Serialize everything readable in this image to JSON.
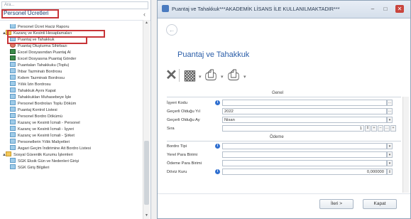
{
  "left_panel": {
    "search_placeholder": "Ara...",
    "title": "Personel Ücretleri",
    "collapse_icon": "chevron-left-icon",
    "tree": [
      {
        "label": "Personel Ücret Haciz Raporu",
        "icon": "doc-icon"
      },
      {
        "label": "Kazanç ve Kesinti Hesaplamaları",
        "icon": "folder-icon",
        "expander": "▲"
      },
      {
        "label": "Puantaj ve Tahakkuk",
        "icon": "doc-icon"
      },
      {
        "label": "Puantaj Oluşturma Sihirbazı",
        "icon": "wizard-icon"
      },
      {
        "label": "Excel Dosyasından Puantaj Al",
        "icon": "excel-icon"
      },
      {
        "label": "Excel Dosyasına Puantaj Gönder",
        "icon": "excel-icon"
      },
      {
        "label": "Puantaları Tahakkuku (Toplu)",
        "icon": "doc-icon"
      },
      {
        "label": "İhbar Tazminatı Bordrosu",
        "icon": "doc-icon"
      },
      {
        "label": "Kıdem Tazminatı Bordrosu",
        "icon": "doc-icon"
      },
      {
        "label": "Yıllık İzin Bordrosu",
        "icon": "doc-icon"
      },
      {
        "label": "Tahakkuk Ayını Kapat",
        "icon": "doc-icon"
      },
      {
        "label": "Tahakkukları Muhasebeye İşle",
        "icon": "doc-icon"
      },
      {
        "label": "Personel Bordroları Toplu Döküm",
        "icon": "doc-icon"
      },
      {
        "label": "Puantaj Kontrol Listesi",
        "icon": "doc-icon"
      },
      {
        "label": "Personel Bordro Dökümü",
        "icon": "doc-icon"
      },
      {
        "label": "Kazanç ve Kesinti İcmali - Personel",
        "icon": "doc-icon"
      },
      {
        "label": "Kazanç ve Kesinti İcmali - İşyeri",
        "icon": "doc-icon"
      },
      {
        "label": "Kazanç ve Kesinti İcmali - Şirket",
        "icon": "doc-icon"
      },
      {
        "label": "Personellerin Yıllık Maliyetleri",
        "icon": "doc-icon"
      },
      {
        "label": "Asgari Geçim İndirimine Ait Bordro Listesi",
        "icon": "doc-icon"
      },
      {
        "label": "Sosyal Güvenlik Kurumu İşlemleri",
        "icon": "folder-icon",
        "expander": "▲"
      },
      {
        "label": "SGK Eksik Gün ve Nedenleri Girişi",
        "icon": "doc-icon"
      },
      {
        "label": "SGK Giriş Bilgileri",
        "icon": "doc-icon"
      }
    ]
  },
  "dialog": {
    "title": "Puantaj ve Tahakkuk***AKADEMİK LİSANS İLE KULLANILMAKTADIR***",
    "minimize": "–",
    "maximize": "□",
    "close": "✕",
    "back_icon": "back-arrow-icon",
    "heading": "Puantaj ve Tahakkuk",
    "toolbar": {
      "delete_icon": "delete-icon",
      "save_icon": "save-icon",
      "print_icon": "print-icon",
      "print_preview_icon": "print-preview-icon"
    },
    "sections": {
      "genel": "Genel",
      "odeme": "Ödeme"
    },
    "fields": {
      "isyeri_kodu": {
        "label": "İşyeri Kodu",
        "value": ""
      },
      "gecerli_yil": {
        "label": "Geçerli Olduğu Yıl",
        "value": "2022"
      },
      "gecerli_ay": {
        "label": "Geçerli Olduğu Ay",
        "value": "Nisan"
      },
      "sira": {
        "label": "Sıra",
        "value": "1"
      },
      "bordro_tipi": {
        "label": "Bordro Tipi",
        "value": ""
      },
      "yerel_para": {
        "label": "Yerel Para Birimi",
        "value": ""
      },
      "odeme_para": {
        "label": "Ödeme Para Birimi",
        "value": ""
      },
      "doviz_kuru": {
        "label": "Döviz Kuru",
        "value": "0,000000"
      }
    },
    "buttons": {
      "next": "İleri >",
      "close": "Kapat"
    }
  }
}
